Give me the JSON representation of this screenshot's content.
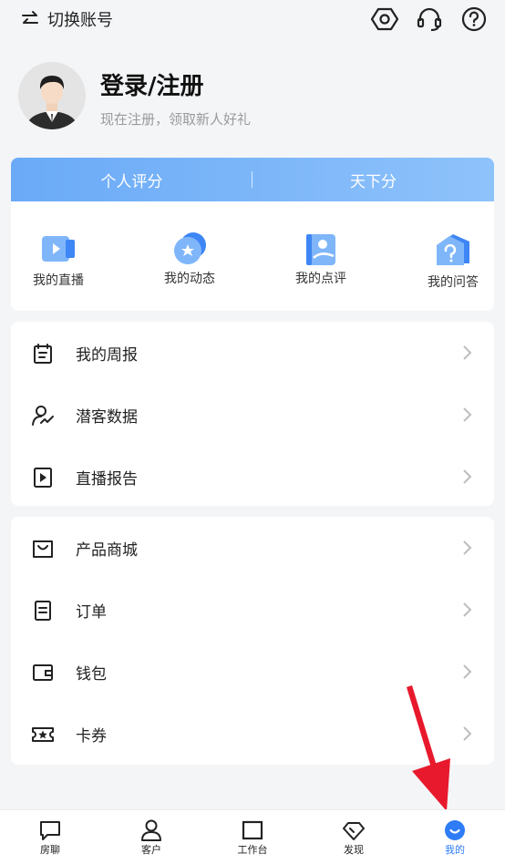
{
  "header": {
    "switch_account_label": "切换账号",
    "icons": [
      "settings-icon",
      "headset-icon",
      "help-icon"
    ]
  },
  "profile": {
    "name": "登录/注册",
    "subtitle": "现在注册，领取新人好礼"
  },
  "score_tabs": [
    {
      "label": "个人评分"
    },
    {
      "label": "天下分"
    }
  ],
  "features": [
    {
      "label": "我的直播",
      "icon": "live-icon"
    },
    {
      "label": "我的动态",
      "icon": "moments-icon"
    },
    {
      "label": "我的点评",
      "icon": "review-icon"
    },
    {
      "label": "我的问答",
      "icon": "qa-icon"
    }
  ],
  "menu_group1": [
    {
      "label": "我的周报",
      "icon": "calendar-icon"
    },
    {
      "label": "潜客数据",
      "icon": "user-chart-icon"
    },
    {
      "label": "直播报告",
      "icon": "play-report-icon"
    }
  ],
  "menu_group2": [
    {
      "label": "产品商城",
      "icon": "shopping-bag-icon"
    },
    {
      "label": "订单",
      "icon": "order-icon"
    },
    {
      "label": "钱包",
      "icon": "wallet-icon"
    },
    {
      "label": "卡券",
      "icon": "coupon-icon"
    }
  ],
  "tabbar": [
    {
      "label": "房聊",
      "icon": "chat-icon"
    },
    {
      "label": "客户",
      "icon": "customer-icon"
    },
    {
      "label": "工作台",
      "icon": "workbench-icon"
    },
    {
      "label": "发现",
      "icon": "discover-icon"
    },
    {
      "label": "我的",
      "icon": "me-icon",
      "active": true
    }
  ],
  "colors": {
    "accent": "#2e7cf6",
    "score_bar_start": "#6aaaf7",
    "score_bar_end": "#8ec2fb",
    "annotation_arrow": "#e8192c"
  }
}
